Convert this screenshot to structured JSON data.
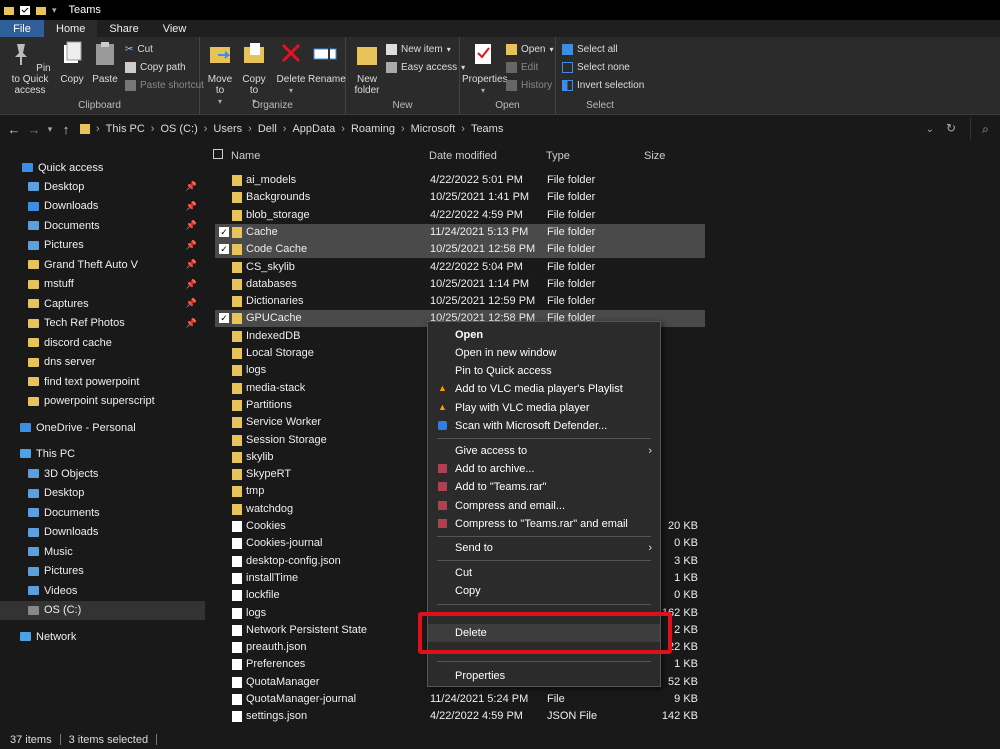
{
  "window": {
    "title": "Teams"
  },
  "tabs": [
    {
      "label": "File"
    },
    {
      "label": "Home"
    },
    {
      "label": "Share"
    },
    {
      "label": "View"
    }
  ],
  "ribbon": {
    "clipboard": {
      "label": "Clipboard",
      "pin": "Pin to Quick access",
      "copy": "Copy",
      "paste": "Paste",
      "cut": "Cut",
      "copy_path": "Copy path",
      "paste_shortcut": "Paste shortcut"
    },
    "organize": {
      "label": "Organize",
      "move_to": "Move to",
      "copy_to": "Copy to",
      "delete": "Delete",
      "rename": "Rename"
    },
    "new": {
      "label": "New",
      "new_folder": "New folder",
      "new_item": "New item",
      "easy_access": "Easy access"
    },
    "open": {
      "label": "Open",
      "properties": "Properties",
      "open": "Open",
      "edit": "Edit",
      "history": "History"
    },
    "select": {
      "label": "Select",
      "select_all": "Select all",
      "select_none": "Select none",
      "invert": "Invert selection"
    }
  },
  "address": {
    "crumbs": [
      "This PC",
      "OS (C:)",
      "Users",
      "Dell",
      "AppData",
      "Roaming",
      "Microsoft",
      "Teams"
    ]
  },
  "sidebar": {
    "quick_access": "Quick access",
    "items": [
      "Desktop",
      "Downloads",
      "Documents",
      "Pictures",
      "Grand Theft Auto V",
      "mstuff",
      "Captures",
      "Tech Ref Photos",
      "discord cache",
      "dns server",
      "find text powerpoint",
      "powerpoint superscript"
    ],
    "onedrive": "OneDrive - Personal",
    "this_pc": "This PC",
    "pc_items": [
      "3D Objects",
      "Desktop",
      "Documents",
      "Downloads",
      "Music",
      "Pictures",
      "Videos",
      "OS (C:)"
    ],
    "network": "Network"
  },
  "columns": {
    "name": "Name",
    "date": "Date modified",
    "type": "Type",
    "size": "Size"
  },
  "files": [
    {
      "name": "ai_models",
      "date": "4/22/2022 5:01 PM",
      "type": "File folder",
      "size": "",
      "folder": true,
      "sel": false
    },
    {
      "name": "Backgrounds",
      "date": "10/25/2021 1:41 PM",
      "type": "File folder",
      "size": "",
      "folder": true,
      "sel": false
    },
    {
      "name": "blob_storage",
      "date": "4/22/2022 4:59 PM",
      "type": "File folder",
      "size": "",
      "folder": true,
      "sel": false
    },
    {
      "name": "Cache",
      "date": "11/24/2021 5:13 PM",
      "type": "File folder",
      "size": "",
      "folder": true,
      "sel": true
    },
    {
      "name": "Code Cache",
      "date": "10/25/2021 12:58 PM",
      "type": "File folder",
      "size": "",
      "folder": true,
      "sel": true
    },
    {
      "name": "CS_skylib",
      "date": "4/22/2022 5:04 PM",
      "type": "File folder",
      "size": "",
      "folder": true,
      "sel": false
    },
    {
      "name": "databases",
      "date": "10/25/2021 1:14 PM",
      "type": "File folder",
      "size": "",
      "folder": true,
      "sel": false
    },
    {
      "name": "Dictionaries",
      "date": "10/25/2021 12:59 PM",
      "type": "File folder",
      "size": "",
      "folder": true,
      "sel": false
    },
    {
      "name": "GPUCache",
      "date": "10/25/2021 12:58 PM",
      "type": "File folder",
      "size": "",
      "folder": true,
      "sel": true
    },
    {
      "name": "IndexedDB",
      "date": "",
      "type": "",
      "size": "",
      "folder": true,
      "sel": false
    },
    {
      "name": "Local Storage",
      "date": "",
      "type": "",
      "size": "",
      "folder": true,
      "sel": false
    },
    {
      "name": "logs",
      "date": "",
      "type": "",
      "size": "",
      "folder": true,
      "sel": false
    },
    {
      "name": "media-stack",
      "date": "",
      "type": "",
      "size": "",
      "folder": true,
      "sel": false
    },
    {
      "name": "Partitions",
      "date": "",
      "type": "",
      "size": "",
      "folder": true,
      "sel": false
    },
    {
      "name": "Service Worker",
      "date": "",
      "type": "",
      "size": "",
      "folder": true,
      "sel": false
    },
    {
      "name": "Session Storage",
      "date": "",
      "type": "",
      "size": "",
      "folder": true,
      "sel": false
    },
    {
      "name": "skylib",
      "date": "",
      "type": "",
      "size": "",
      "folder": true,
      "sel": false
    },
    {
      "name": "SkypeRT",
      "date": "",
      "type": "",
      "size": "",
      "folder": true,
      "sel": false
    },
    {
      "name": "tmp",
      "date": "",
      "type": "",
      "size": "",
      "folder": true,
      "sel": false
    },
    {
      "name": "watchdog",
      "date": "",
      "type": "",
      "size": "",
      "folder": true,
      "sel": false
    },
    {
      "name": "Cookies",
      "date": "",
      "type": "",
      "size": "20 KB",
      "folder": false,
      "sel": false
    },
    {
      "name": "Cookies-journal",
      "date": "",
      "type": "",
      "size": "0 KB",
      "folder": false,
      "sel": false
    },
    {
      "name": "desktop-config.json",
      "date": "",
      "type": "",
      "size": "3 KB",
      "folder": false,
      "sel": false
    },
    {
      "name": "installTime",
      "date": "",
      "type": "",
      "size": "1 KB",
      "folder": false,
      "sel": false
    },
    {
      "name": "lockfile",
      "date": "",
      "type": "",
      "size": "0 KB",
      "folder": false,
      "sel": false
    },
    {
      "name": "logs",
      "date": "",
      "type": "",
      "size": "162 KB",
      "folder": false,
      "sel": false
    },
    {
      "name": "Network Persistent State",
      "date": "",
      "type": "",
      "size": "2 KB",
      "folder": false,
      "sel": false
    },
    {
      "name": "preauth.json",
      "date": "",
      "type": "",
      "size": "22 KB",
      "folder": false,
      "sel": false
    },
    {
      "name": "Preferences",
      "date": "",
      "type": "",
      "size": "1 KB",
      "folder": false,
      "sel": false
    },
    {
      "name": "QuotaManager",
      "date": "",
      "type": "",
      "size": "52 KB",
      "folder": false,
      "sel": false
    },
    {
      "name": "QuotaManager-journal",
      "date": "11/24/2021 5:24 PM",
      "type": "File",
      "size": "9 KB",
      "folder": false,
      "sel": false
    },
    {
      "name": "settings.json",
      "date": "4/22/2022 4:59 PM",
      "type": "JSON File",
      "size": "142 KB",
      "folder": false,
      "sel": false
    }
  ],
  "context_menu": {
    "open": "Open",
    "open_new_window": "Open in new window",
    "pin_quick": "Pin to Quick access",
    "vlc_playlist": "Add to VLC media player's Playlist",
    "vlc_play": "Play with VLC media player",
    "defender": "Scan with Microsoft Defender...",
    "give_access": "Give access to",
    "add_archive": "Add to archive...",
    "add_rar": "Add to \"Teams.rar\"",
    "compress_email": "Compress and email...",
    "compress_rar_email": "Compress to \"Teams.rar\" and email",
    "send_to": "Send to",
    "cut": "Cut",
    "copy": "Copy",
    "delete": "Delete",
    "properties": "Properties"
  },
  "status": {
    "count": "37 items",
    "selected": "3 items selected"
  },
  "colors": {
    "folder": "#e8c35a",
    "highlight": "#e0101a",
    "file_tab": "#2e5f99"
  }
}
